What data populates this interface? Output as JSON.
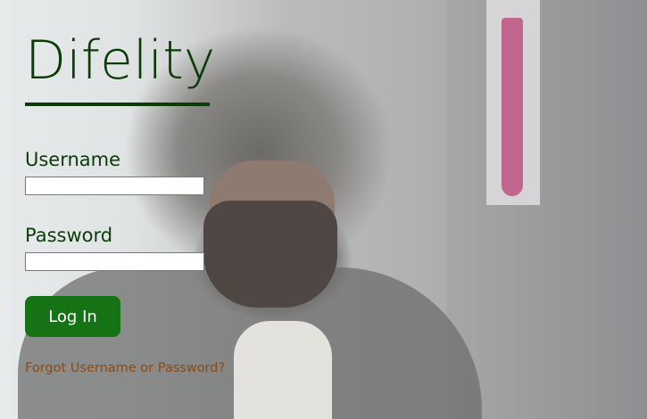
{
  "brand": {
    "name": "Difelity"
  },
  "form": {
    "username_label": "Username",
    "username_value": "",
    "password_label": "Password",
    "password_value": "",
    "login_button": "Log In",
    "forgot_link": "Forgot Username or Password?"
  },
  "colors": {
    "brand_green": "#0b3b07",
    "button_green": "#167315",
    "link_brown": "#8a4a14"
  }
}
